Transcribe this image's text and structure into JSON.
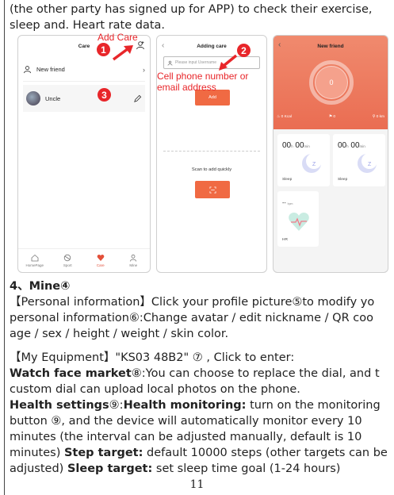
{
  "intro_line1": "(the other party has signed up for APP) to check their exercise,",
  "intro_line2": "sleep and. Heart rate data.",
  "phone1": {
    "title": "Care",
    "new_friend": "New friend",
    "contact": "Uncle",
    "tabs": [
      "HomePage",
      "Sport",
      "Care",
      "Mine"
    ]
  },
  "phone2": {
    "title": "Adding care",
    "input_placeholder": "Please input Username",
    "add_button": "Add",
    "scan_text": "Scan to add quickly"
  },
  "phone3": {
    "title": "New friend",
    "ring_value": "0",
    "stats": [
      "0 Kcal",
      "0",
      "0 km"
    ],
    "sleep_value": "00",
    "sleep_unit_h": "h",
    "sleep_unit_min": "min",
    "sleep_label": "Sleep",
    "hr_value": "--",
    "hr_unit": "bpm",
    "hr_label": "HR"
  },
  "annotations": {
    "add_care": "Add Care",
    "badge1": "1",
    "badge2": "2",
    "badge3": "3",
    "cell_line1": "Cell phone number or",
    "cell_line2": "email address"
  },
  "section4": {
    "heading": "4、Mine④",
    "personal_line1": "【Personal information】Click your profile picture⑤to modify yo",
    "personal_line2": "personal information⑥:Change avatar / edit nickname / QR coo",
    "personal_line3": "age / sex / height / weight / skin color.",
    "equip_line": "【My Equipment】\"KS03 48B2\" ⑦ , Click to enter:",
    "watch_bold": "Watch face market",
    "watch_rest": "⑧:You can choose to replace the dial, and t",
    "watch_line2": "custom dial can upload local photos on the phone.",
    "health_bold": "Health settings",
    "health_mid": "⑨:",
    "health_bold2": "Health monitoring:",
    "health_rest": " turn on the monitoring",
    "health_line2": "button ⑨, and the device will automatically monitor every 10",
    "health_line3": "minutes (the interval can be adjusted manually, default is 10",
    "health_line4_a": "minutes)  ",
    "step_bold": "Step target:",
    "health_line4_b": " default 10000 steps (other targets can be",
    "health_line5_a": "adjusted)  ",
    "sleep_bold": "Sleep target:",
    "health_line5_b": " set sleep time goal (1-24 hours)"
  },
  "page_number": "11",
  "colors": {
    "accent_red": "#e8262a",
    "app_orange": "#f06a43"
  }
}
